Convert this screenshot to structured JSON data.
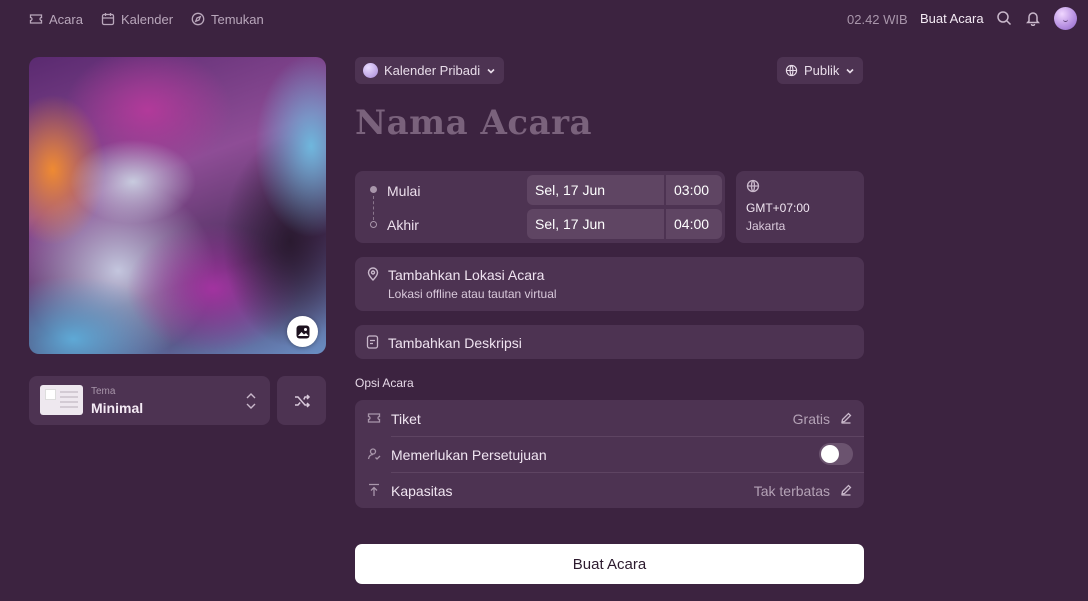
{
  "nav": {
    "items": [
      {
        "label": "Acara",
        "icon": "ticket-icon"
      },
      {
        "label": "Kalender",
        "icon": "calendar-icon"
      },
      {
        "label": "Temukan",
        "icon": "compass-icon"
      }
    ],
    "time": "02.42 WIB",
    "create_label": "Buat Acara",
    "icons": [
      "search-icon",
      "bell-icon",
      "avatar"
    ]
  },
  "cover": {
    "change_icon": "image-icon"
  },
  "theme": {
    "label": "Tema",
    "value": "Minimal"
  },
  "calendar_select": {
    "label": "Kalender Pribadi"
  },
  "visibility": {
    "label": "Publik"
  },
  "event": {
    "title_placeholder": "Nama Acara"
  },
  "datetime": {
    "start_label": "Mulai",
    "start_date": "Sel, 17 Jun",
    "start_time": "03:00",
    "end_label": "Akhir",
    "end_date": "Sel, 17 Jun",
    "end_time": "04:00"
  },
  "timezone": {
    "offset": "GMT+07:00",
    "city": "Jakarta"
  },
  "location": {
    "title": "Tambahkan Lokasi Acara",
    "subtitle": "Lokasi offline atau tautan virtual"
  },
  "description": {
    "label": "Tambahkan Deskripsi"
  },
  "options": {
    "heading": "Opsi Acara",
    "ticket": {
      "label": "Tiket",
      "value": "Gratis"
    },
    "approval": {
      "label": "Memerlukan Persetujuan",
      "enabled": false
    },
    "capacity": {
      "label": "Kapasitas",
      "value": "Tak terbatas"
    }
  },
  "submit_label": "Buat Acara",
  "colors": {
    "background": "#3c2340",
    "card": "#4d3352",
    "button": "#ffffff"
  }
}
